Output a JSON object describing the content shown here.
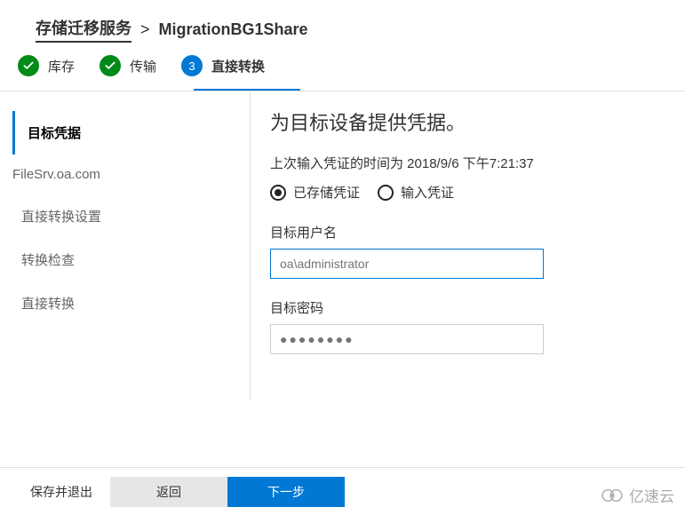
{
  "breadcrumb": {
    "root": "存储迁移服务",
    "separator": ">",
    "current": "MigrationBG1Share"
  },
  "steps": [
    {
      "label": "库存",
      "state": "done"
    },
    {
      "label": "传输",
      "state": "done"
    },
    {
      "label": "直接转换",
      "state": "active",
      "number": "3"
    }
  ],
  "sidebar": {
    "items": [
      {
        "label": "目标凭据",
        "active": true
      },
      {
        "label": "FileSrv.oa.com",
        "active": false
      },
      {
        "label": "直接转换设置",
        "active": false
      },
      {
        "label": "转换检查",
        "active": false
      },
      {
        "label": "直接转换",
        "active": false
      }
    ]
  },
  "content": {
    "heading": "为目标设备提供凭据。",
    "last_saved": "上次输入凭证的时间为 2018/9/6 下午7:21:37",
    "radio": {
      "stored": "已存储凭证",
      "enter": "输入凭证"
    },
    "username": {
      "label": "目标用户名",
      "placeholder": "oa\\administrator"
    },
    "password": {
      "label": "目标密码",
      "placeholder": "●●●●●●●●"
    }
  },
  "footer": {
    "save_exit": "保存并退出",
    "back": "返回",
    "next": "下一步"
  },
  "watermark": "亿速云"
}
